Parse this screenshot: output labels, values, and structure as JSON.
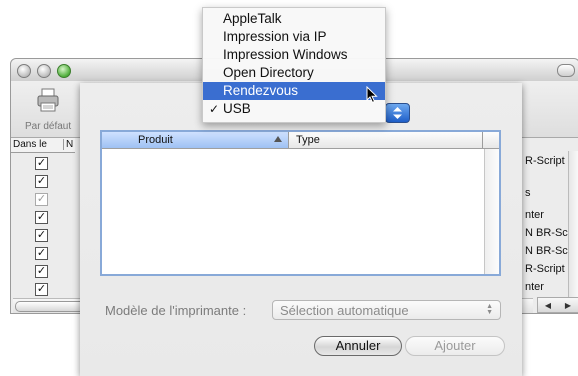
{
  "bg_window": {
    "toolbar_label": "Par défaut",
    "col_headers": [
      "Dans le",
      "N"
    ],
    "checks": [
      {
        "state": "checked",
        "dim": false
      },
      {
        "state": "checked",
        "dim": false
      },
      {
        "state": "checked",
        "dim": true
      },
      {
        "state": "checked",
        "dim": false
      },
      {
        "state": "checked",
        "dim": false
      },
      {
        "state": "checked",
        "dim": false
      },
      {
        "state": "checked",
        "dim": false
      },
      {
        "state": "checked",
        "dim": false
      }
    ],
    "right_items": [
      "R-Script",
      "s",
      "nter",
      "N BR-Scri",
      "N BR-Scri",
      "R-Script",
      "nter"
    ]
  },
  "menu": {
    "items": [
      {
        "label": "AppleTalk",
        "checked": false,
        "selected": false
      },
      {
        "label": "Impression via IP",
        "checked": false,
        "selected": false
      },
      {
        "label": "Impression Windows",
        "checked": false,
        "selected": false
      },
      {
        "label": "Open Directory",
        "checked": false,
        "selected": false
      },
      {
        "label": "Rendezvous",
        "checked": false,
        "selected": true
      },
      {
        "label": "USB",
        "checked": true,
        "selected": false
      }
    ],
    "checkmark": "✓"
  },
  "table": {
    "columns": [
      "Produit",
      "Type"
    ],
    "rows": []
  },
  "model": {
    "label": "Modèle de l'imprimante :",
    "value": "Sélection automatique"
  },
  "buttons": {
    "cancel": "Annuler",
    "add": "Ajouter"
  },
  "colors": {
    "selection": "#3a6ed0",
    "table_border": "#88a9d8",
    "header_sorted": "#9ec1f3"
  }
}
